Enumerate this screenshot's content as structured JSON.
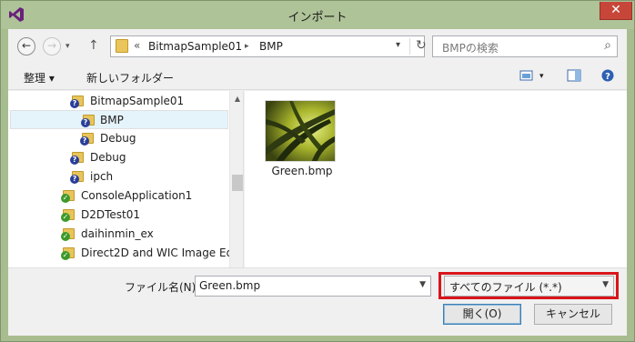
{
  "window": {
    "title": "インポート",
    "close_glyph": "✕"
  },
  "address": {
    "overflow_glyph": "«",
    "crumbs": [
      "BitmapSample01",
      "BMP"
    ],
    "separator": "▸",
    "search_placeholder": "BMPの検索"
  },
  "toolbar": {
    "organize_label": "整理 ▾",
    "new_folder_label": "新しいフォルダー"
  },
  "tree": {
    "items": [
      {
        "label": "BitmapSample01",
        "badge": "?"
      },
      {
        "label": "BMP",
        "badge": "?"
      },
      {
        "label": "Debug",
        "badge": "?"
      },
      {
        "label": "Debug",
        "badge": "?"
      },
      {
        "label": "ipch",
        "badge": "?"
      },
      {
        "label": "ConsoleApplication1",
        "badge": "✓"
      },
      {
        "label": "D2DTest01",
        "badge": "✓"
      },
      {
        "label": "daihinmin_ex",
        "badge": "✓"
      },
      {
        "label": "Direct2D and WIC Image Ed",
        "badge": "✓"
      }
    ]
  },
  "files": [
    {
      "name": "Green.bmp"
    }
  ],
  "bottom": {
    "filename_label": "ファイル名(N):",
    "filename_value": "Green.bmp",
    "filetype_value": "すべてのファイル (*.*)",
    "open_label": "開く(O)",
    "cancel_label": "キャンセル"
  },
  "colors": {
    "frame": "#aec398",
    "highlight": "#d9141b",
    "selection": "#e5f3fb"
  }
}
